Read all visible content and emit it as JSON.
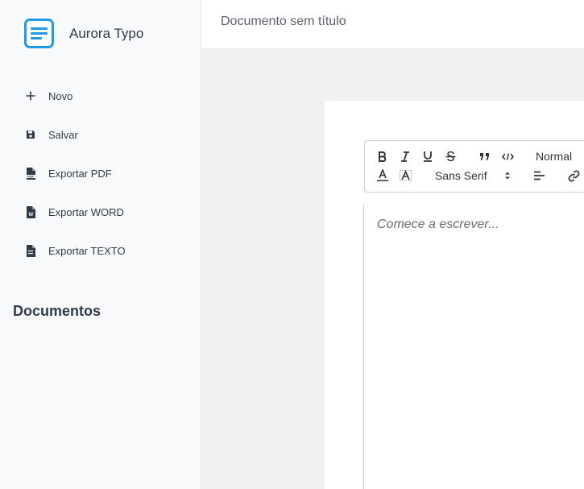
{
  "brand": {
    "name": "Aurora Typo"
  },
  "menu": [
    {
      "label": "Novo",
      "icon": "plus-icon"
    },
    {
      "label": "Salvar",
      "icon": "floppy-disk-icon"
    },
    {
      "label": "Exportar PDF",
      "icon": "pdf-file-icon"
    },
    {
      "label": "Exportar WORD",
      "icon": "word-file-icon"
    },
    {
      "label": "Exportar TEXTO",
      "icon": "text-file-icon"
    }
  ],
  "sidebar": {
    "section_title": "Documentos"
  },
  "header": {
    "document_title": "Documento sem título"
  },
  "toolbar": {
    "header_select": "Normal",
    "font_select": "Sans Serif"
  },
  "editor": {
    "placeholder": "Comece a escrever..."
  },
  "colors": {
    "accent": "#1e9be9",
    "sidebar_bg": "#f8f9fb",
    "canvas_bg": "#f0f0f0"
  }
}
